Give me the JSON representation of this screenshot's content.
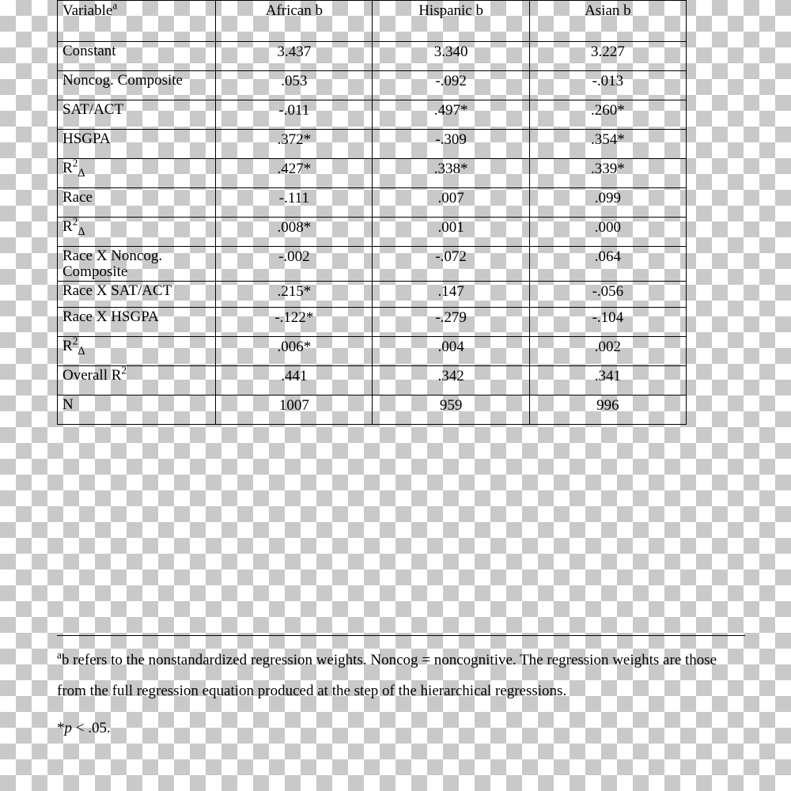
{
  "headers": {
    "variable": "Variable",
    "variable_sup": "a",
    "col1": "African b",
    "col2": "Hispanic b",
    "col3": "Asian b"
  },
  "rows": [
    {
      "label_html": "Constant",
      "c1": "3.437",
      "c2": "3.340",
      "c3": "3.227"
    },
    {
      "label_html": "Noncog. Composite",
      "c1": ".053",
      "c2": "-.092",
      "c3": "-.013"
    },
    {
      "label_html": "SAT/ACT",
      "c1": "-.011",
      "c2": ".497*",
      "c3": ".260*"
    },
    {
      "label_html": "HSGPA",
      "c1": ".372*",
      "c2": "-.309",
      "c3": ".354*"
    },
    {
      "label_html": "R<sup>2</sup><span class=\"sub-delta\">Δ</span>",
      "c1": ".427*",
      "c2": ".338*",
      "c3": ".339*"
    },
    {
      "label_html": "Race",
      "c1": "-.111",
      "c2": ".007",
      "c3": ".099"
    },
    {
      "label_html": "R<sup>2</sup><span class=\"sub-delta\">Δ</span>",
      "c1": ".008*",
      "c2": ".001",
      "c3": ".000"
    },
    {
      "label_html": "Race X Noncog.<br>Composite",
      "c1": "-.002",
      "c2": "-.072",
      "c3": ".064",
      "tall": true
    },
    {
      "label_html": "Race X SAT/ACT",
      "c1": ".215*",
      "c2": ".147",
      "c3": "-.056",
      "short": true
    },
    {
      "label_html": "Race X HSGPA",
      "c1": "-.122*",
      "c2": "-.279",
      "c3": "-.104"
    },
    {
      "label_html": "R<sup>2</sup><span class=\"sub-delta\">Δ</span>",
      "c1": ".006*",
      "c2": ".004",
      "c3": ".002"
    },
    {
      "label_html": "Overall R<sup>2</sup>",
      "c1": ".441",
      "c2": ".342",
      "c3": ".341"
    },
    {
      "label_html": "N",
      "c1": "1007",
      "c2": "959",
      "c3": "996"
    }
  ],
  "footnote_a_sup": "a",
  "footnote_a_text": "b refers to the nonstandardized regression weights. Noncog = noncognitive. The regression weights are those from the full regression equation produced at the step of the hierarchical regressions.",
  "footnote_p": "*p < .05.",
  "chart_data": {
    "type": "table",
    "title": "Hierarchical regression results by race group",
    "columns": [
      "Variable",
      "African b",
      "Hispanic b",
      "Asian b"
    ],
    "rows": [
      [
        "Constant",
        3.437,
        3.34,
        3.227
      ],
      [
        "Noncog. Composite",
        0.053,
        -0.092,
        -0.013
      ],
      [
        "SAT/ACT",
        -0.011,
        0.497,
        0.26
      ],
      [
        "HSGPA",
        0.372,
        -0.309,
        0.354
      ],
      [
        "R^2 Δ (Step 1)",
        0.427,
        0.338,
        0.339
      ],
      [
        "Race",
        -0.111,
        0.007,
        0.099
      ],
      [
        "R^2 Δ (Step 2)",
        0.008,
        0.001,
        0.0
      ],
      [
        "Race X Noncog. Composite",
        -0.002,
        -0.072,
        0.064
      ],
      [
        "Race X SAT/ACT",
        0.215,
        0.147,
        -0.056
      ],
      [
        "Race X HSGPA",
        -0.122,
        -0.279,
        -0.104
      ],
      [
        "R^2 Δ (Step 3)",
        0.006,
        0.004,
        0.002
      ],
      [
        "Overall R^2",
        0.441,
        0.342,
        0.341
      ],
      [
        "N",
        1007,
        959,
        996
      ]
    ],
    "significance": {
      "threshold": 0.05,
      "marked": [
        [
          "SAT/ACT",
          "Hispanic b"
        ],
        [
          "SAT/ACT",
          "Asian b"
        ],
        [
          "HSGPA",
          "African b"
        ],
        [
          "HSGPA",
          "Asian b"
        ],
        [
          "R^2 Δ (Step 1)",
          "African b"
        ],
        [
          "R^2 Δ (Step 1)",
          "Hispanic b"
        ],
        [
          "R^2 Δ (Step 1)",
          "Asian b"
        ],
        [
          "R^2 Δ (Step 2)",
          "African b"
        ],
        [
          "Race X SAT/ACT",
          "African b"
        ],
        [
          "Race X HSGPA",
          "African b"
        ],
        [
          "R^2 Δ (Step 3)",
          "African b"
        ]
      ]
    },
    "notes": [
      "b refers to the nonstandardized regression weights.",
      "Noncog = noncognitive.",
      "The regression weights are those from the full regression equation produced at the step of the hierarchical regressions.",
      "* p < .05."
    ]
  }
}
